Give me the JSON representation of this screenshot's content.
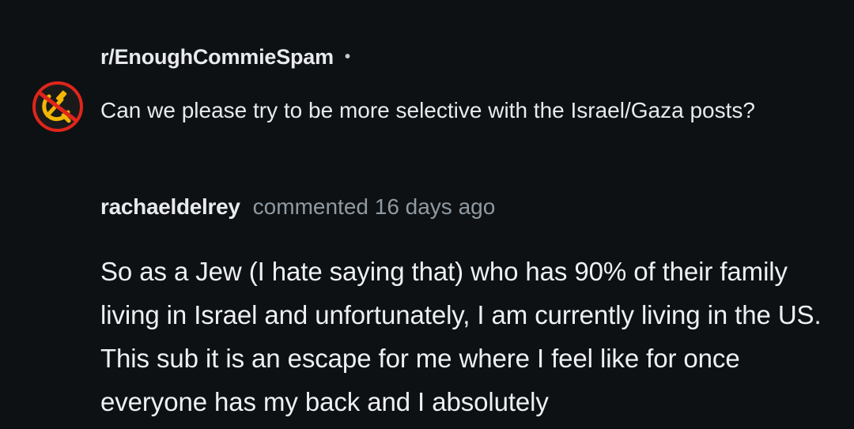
{
  "post": {
    "subreddit": "r/EnoughCommieSpam",
    "separator": "•",
    "title": "Can we please try to be more selective with the Israel/Gaza posts?",
    "avatar_icon": "crossed-out-hammer-and-sickle-icon"
  },
  "comment": {
    "username": "rachaeldelrey",
    "meta": "commented 16 days ago",
    "body": "So as a Jew (I hate saying that) who has 90% of their family living in Israel and unfortunately, I am currently living in the US. This sub it is an escape for me where I feel like for once everyone has my back and I absolutely"
  },
  "colors": {
    "background": "#0e1113",
    "text": "#e8eaed",
    "meta": "#8f9aa3",
    "avatar_red": "#e0251b",
    "avatar_yellow": "#f2b705"
  }
}
